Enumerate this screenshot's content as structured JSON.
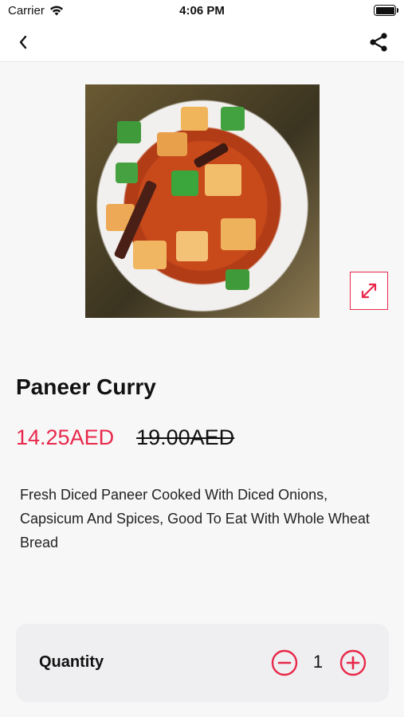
{
  "status_bar": {
    "carrier": "Carrier",
    "time": "4:06 PM"
  },
  "nav": {
    "back_icon": "chevron-left-icon",
    "share_icon": "share-icon"
  },
  "product": {
    "name": "Paneer Curry",
    "price_current": "14.25AED",
    "price_original": "19.00AED",
    "description": "Fresh Diced Paneer Cooked With Diced Onions, Capsicum And Spices, Good To Eat With Whole Wheat Bread",
    "expand_icon": "expand-icon"
  },
  "quantity": {
    "label": "Quantity",
    "value": "1",
    "decrease_icon": "minus-circle-icon",
    "increase_icon": "plus-circle-icon"
  },
  "colors": {
    "accent": "#e8284a",
    "background": "#f7f7f8",
    "card": "#efeff1"
  }
}
